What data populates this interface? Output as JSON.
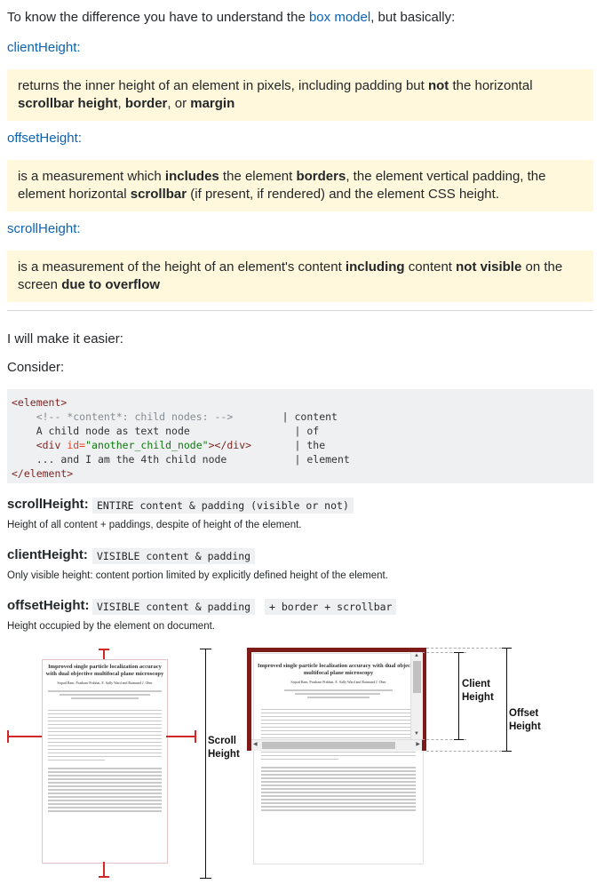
{
  "intro": {
    "before": "To know the difference you have to understand the ",
    "link": "box model",
    "after": ", but basically:"
  },
  "terms": {
    "client": "clientHeight",
    "offset": "offsetHeight",
    "scroll": "scrollHeight",
    "colon": ":"
  },
  "client_box": {
    "t1": "returns the inner height of an element in pixels, including padding but ",
    "b1": "not",
    "t2": " the horizontal ",
    "b2": "scrollbar height",
    "t3": ", ",
    "b3": "border",
    "t4": ", or ",
    "b4": "margin"
  },
  "offset_box": {
    "t1": "is a measurement which ",
    "b1": "includes",
    "t2": " the element ",
    "b2": "borders",
    "t3": ", the element vertical padding, the element horizontal ",
    "b3": "scrollbar",
    "t4": " (if present, if rendered) and the element CSS height."
  },
  "scroll_box": {
    "t1": "is a measurement of the height of an element's content ",
    "b1": "including",
    "t2": " content ",
    "b2": "not visible",
    "t3": " on the screen ",
    "b3": "due to overflow"
  },
  "easier": "I will make it easier:",
  "consider": "Consider:",
  "code": {
    "open": "<element>",
    "comment": "<!-- *content*: child nodes: -->",
    "line2": "A child node as text node",
    "div_open": "<div ",
    "div_attr": "id=",
    "div_val": "\"another_child_node\"",
    "div_close": "></div>",
    "line4": "... and I am the 4th child node",
    "close": "</element>",
    "side": [
      "| content",
      "| of",
      "| the",
      "| element"
    ]
  },
  "defs": [
    {
      "prop": "scrollHeight",
      "colon": ":",
      "kw1": "ENTIRE  content & padding (visible or not)",
      "kw2": "",
      "desc": "Height of all content + paddings, despite of height of the element."
    },
    {
      "prop": "clientHeight",
      "colon": ":",
      "kw1": "VISIBLE content & padding",
      "kw2": "",
      "desc": "Only visible height: content portion limited by explicitly defined height of the element."
    },
    {
      "prop": "offsetHeight",
      "colon": ":",
      "kw1": "VISIBLE content & padding",
      "kw2": "+ border + scrollbar",
      "desc": "Height occupied by the element on document."
    }
  ],
  "diagram": {
    "doc_title": "Improved single particle localization accuracy with dual objective multifocal plane microscopy",
    "doc_authors": "Sripad Ram, Prashant Prabhat, E. Sally Ward and Raimund J. Ober",
    "label_scroll": [
      "Scroll",
      "Height"
    ],
    "label_client": [
      "Client",
      "Height"
    ],
    "label_offset": [
      "Offset",
      "Height"
    ],
    "colors": {
      "accent": "#d42727",
      "frame": "#7d1b1b"
    }
  }
}
